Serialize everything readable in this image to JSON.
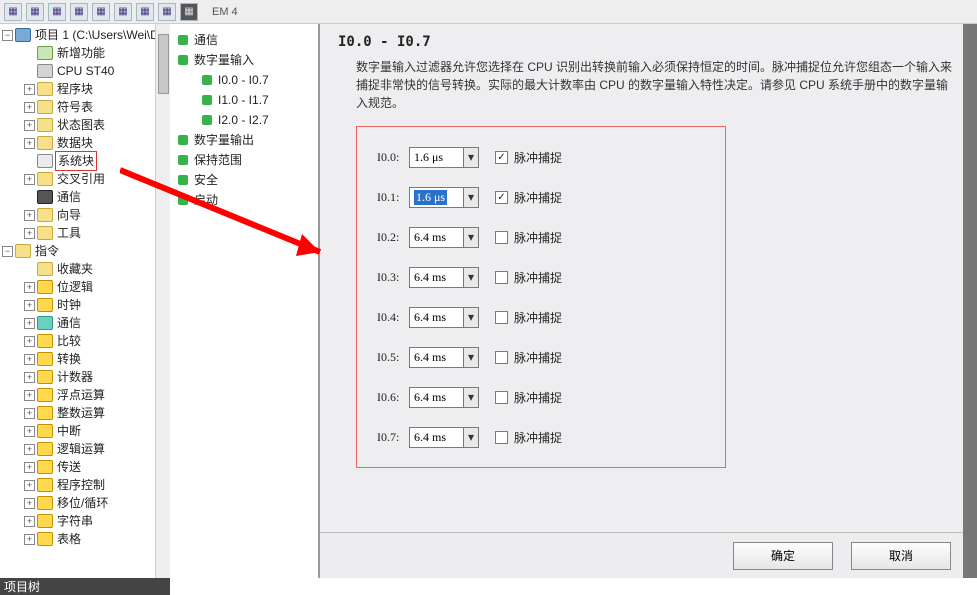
{
  "toolbar": {
    "em_label": "EM 4"
  },
  "left_tree": {
    "root_title": "项目 1 (C:\\Users\\Wei\\D",
    "items": [
      {
        "icon": "i-pg",
        "label": "新增功能",
        "indent": 24,
        "exp": null
      },
      {
        "icon": "i-cpu",
        "label": "CPU ST40",
        "indent": 24,
        "exp": null
      },
      {
        "icon": "i-fld",
        "label": "程序块",
        "indent": 24,
        "exp": "+"
      },
      {
        "icon": "i-fld",
        "label": "符号表",
        "indent": 24,
        "exp": "+"
      },
      {
        "icon": "i-fld",
        "label": "状态图表",
        "indent": 24,
        "exp": "+"
      },
      {
        "icon": "i-fld",
        "label": "数据块",
        "indent": 24,
        "exp": "+"
      },
      {
        "icon": "i-sys",
        "label": "系统块",
        "indent": 24,
        "exp": null,
        "boxed": true
      },
      {
        "icon": "i-fld",
        "label": "交叉引用",
        "indent": 24,
        "exp": "+"
      },
      {
        "icon": "i-dev",
        "label": "通信",
        "indent": 24,
        "exp": null
      },
      {
        "icon": "i-fld",
        "label": "向导",
        "indent": 24,
        "exp": "+"
      },
      {
        "icon": "i-fld",
        "label": "工具",
        "indent": 24,
        "exp": "+"
      }
    ],
    "section2": "指令",
    "items2": [
      {
        "icon": "i-fld",
        "label": "收藏夹",
        "exp": null
      },
      {
        "icon": "i-cmd",
        "label": "位逻辑",
        "exp": "+"
      },
      {
        "icon": "i-cmd",
        "label": "时钟",
        "exp": "+"
      },
      {
        "icon": "i-teal",
        "label": "通信",
        "exp": "+"
      },
      {
        "icon": "i-cmd",
        "label": "比较",
        "exp": "+"
      },
      {
        "icon": "i-cmd",
        "label": "转换",
        "exp": "+"
      },
      {
        "icon": "i-cmd",
        "label": "计数器",
        "exp": "+"
      },
      {
        "icon": "i-cmd",
        "label": "浮点运算",
        "exp": "+"
      },
      {
        "icon": "i-cmd",
        "label": "整数运算",
        "exp": "+"
      },
      {
        "icon": "i-cmd",
        "label": "中断",
        "exp": "+"
      },
      {
        "icon": "i-cmd",
        "label": "逻辑运算",
        "exp": "+"
      },
      {
        "icon": "i-cmd",
        "label": "传送",
        "exp": "+"
      },
      {
        "icon": "i-cmd",
        "label": "程序控制",
        "exp": "+"
      },
      {
        "icon": "i-cmd",
        "label": "移位/循环",
        "exp": "+"
      },
      {
        "icon": "i-cmd",
        "label": "字符串",
        "exp": "+"
      },
      {
        "icon": "i-cmd",
        "label": "表格",
        "exp": "+"
      }
    ],
    "bottom_label": "项目树"
  },
  "mid_tree": {
    "items": [
      {
        "label": "通信",
        "indent": 8,
        "sub": false
      },
      {
        "label": "数字量输入",
        "indent": 8,
        "sub": false
      },
      {
        "label": "I0.0 - I0.7",
        "indent": 32,
        "sub": true
      },
      {
        "label": "I1.0 - I1.7",
        "indent": 32,
        "sub": true
      },
      {
        "label": "I2.0 - I2.7",
        "indent": 32,
        "sub": true
      },
      {
        "label": "数字量输出",
        "indent": 8,
        "sub": false
      },
      {
        "label": "保持范围",
        "indent": 8,
        "sub": false
      },
      {
        "label": "安全",
        "indent": 8,
        "sub": false
      },
      {
        "label": "启动",
        "indent": 8,
        "sub": false
      }
    ]
  },
  "right": {
    "title": "I0.0 - I0.7",
    "desc": "数字量输入过滤器允许您选择在 CPU 识别出转换前输入必须保持恒定的时间。脉冲捕捉位允许您组态一个输入来捕捉非常快的信号转换。实际的最大计数率由 CPU 的数字量输入特性决定。请参见 CPU 系统手册中的数字量输入规范。",
    "rows": [
      {
        "label": "I0.0:",
        "value": "1.6 μs",
        "checked": true,
        "checklabel": "脉冲捕捉",
        "highlight": false
      },
      {
        "label": "I0.1:",
        "value": "1.6 μs",
        "checked": true,
        "checklabel": "脉冲捕捉",
        "highlight": true
      },
      {
        "label": "I0.2:",
        "value": "6.4 ms",
        "checked": false,
        "checklabel": "脉冲捕捉",
        "highlight": false
      },
      {
        "label": "I0.3:",
        "value": "6.4 ms",
        "checked": false,
        "checklabel": "脉冲捕捉",
        "highlight": false
      },
      {
        "label": "I0.4:",
        "value": "6.4 ms",
        "checked": false,
        "checklabel": "脉冲捕捉",
        "highlight": false
      },
      {
        "label": "I0.5:",
        "value": "6.4 ms",
        "checked": false,
        "checklabel": "脉冲捕捉",
        "highlight": false
      },
      {
        "label": "I0.6:",
        "value": "6.4 ms",
        "checked": false,
        "checklabel": "脉冲捕捉",
        "highlight": false
      },
      {
        "label": "I0.7:",
        "value": "6.4 ms",
        "checked": false,
        "checklabel": "脉冲捕捉",
        "highlight": false
      }
    ],
    "ok": "确定",
    "cancel": "取消"
  }
}
